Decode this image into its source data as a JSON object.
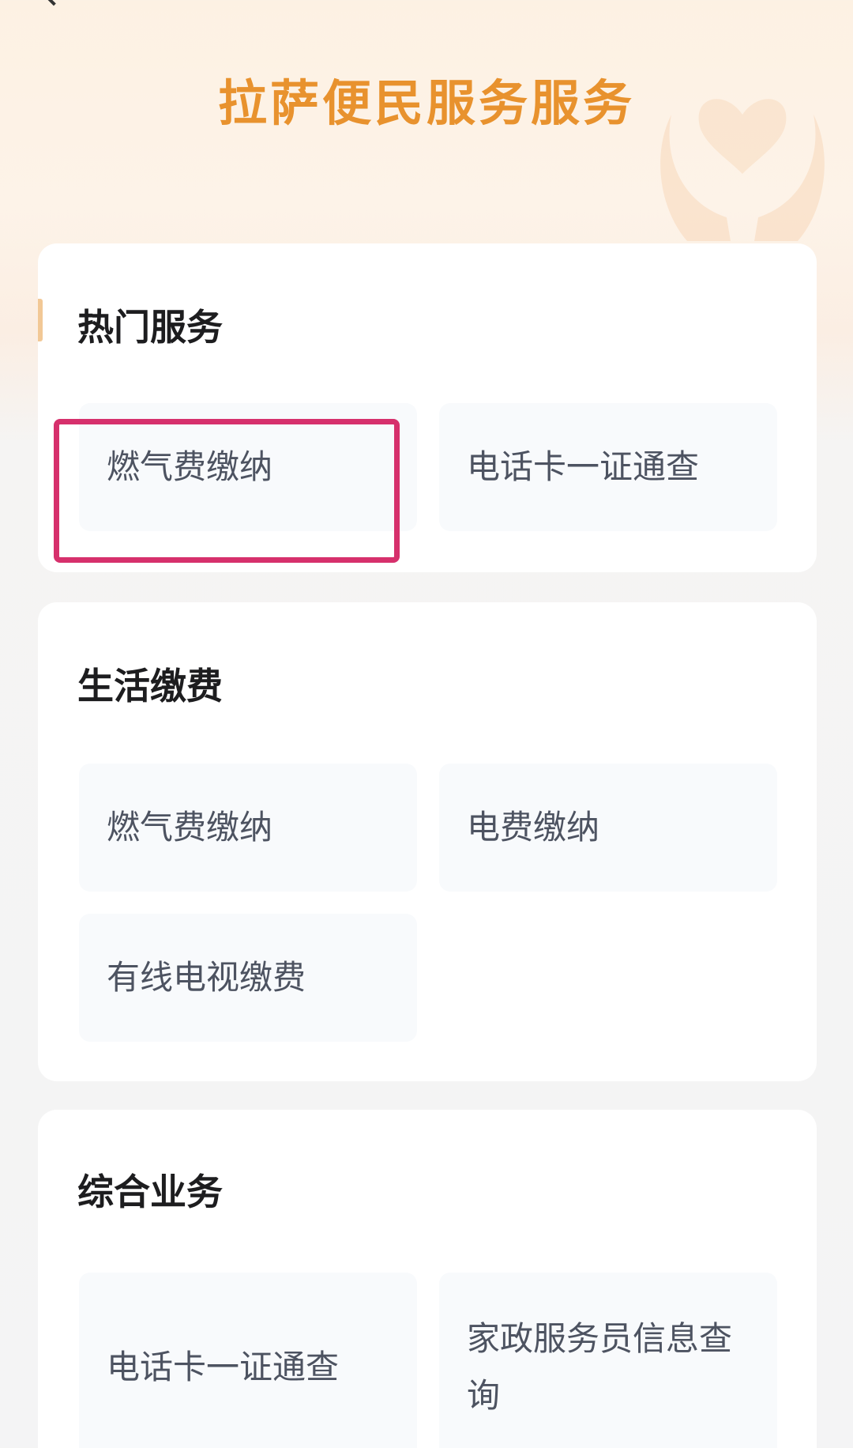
{
  "header": {
    "title": "拉萨便民服务服务",
    "back_icon": "chevron-left-icon",
    "decoration_icon": "heart-hands-icon"
  },
  "sections": [
    {
      "title": "热门服务",
      "items": [
        "燃气费缴纳",
        "电话卡一证通查"
      ]
    },
    {
      "title": "生活缴费",
      "items": [
        "燃气费缴纳",
        "电费缴纳",
        "有线电视缴费"
      ]
    },
    {
      "title": "综合业务",
      "items": [
        "电话卡一证通查",
        "家政服务员信息查询"
      ]
    }
  ],
  "colors": {
    "title_orange": "#e8922e",
    "accent_bar": "#f2c896",
    "highlight_box": "#d6306c",
    "tile_bg": "#f8fafc",
    "tile_text": "#4d5361"
  }
}
